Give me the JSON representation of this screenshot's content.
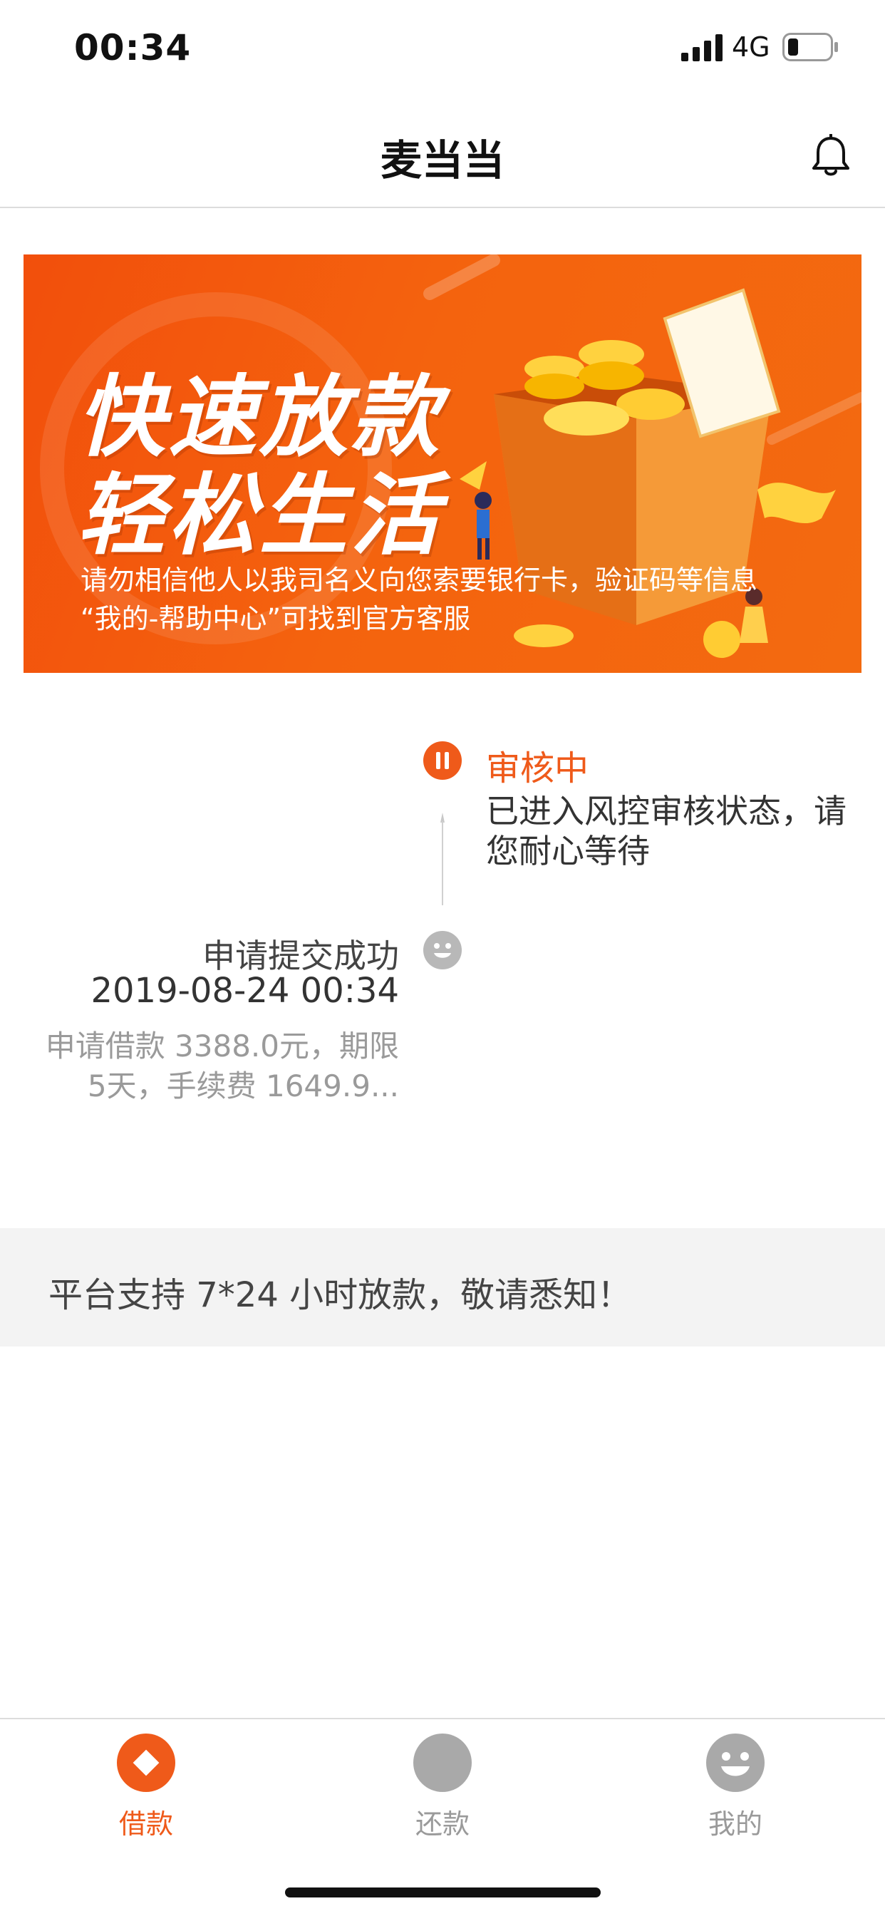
{
  "status_bar": {
    "time": "00:34",
    "network": "4G",
    "icons": [
      "signal-bars-icon",
      "battery-icon"
    ]
  },
  "nav": {
    "title": "麦当当",
    "right_icon": "bell-icon"
  },
  "banner": {
    "headline_line1": "快速放款",
    "headline_line2": "轻松生活",
    "warning_line1": "请勿相信他人以我司名义向您索要银行卡，验证码等信息",
    "warning_line2": "“我的-帮助中心”可找到官方客服"
  },
  "timeline": {
    "review": {
      "title": "审核中",
      "description": "已进入风控审核状态，请您耐心等待",
      "icon": "pause-icon"
    },
    "submitted": {
      "title": "申请提交成功",
      "time": "2019-08-24 00:34",
      "description": "申请借款 3388.0元，期限 5天，手续费 1649.9...",
      "icon": "smile-icon"
    }
  },
  "notice": {
    "text": "平台支持 7*24 小时放款，敬请悉知！"
  },
  "tabbar": {
    "tabs": [
      {
        "label": "借款",
        "icon": "diamond-icon",
        "active": true
      },
      {
        "label": "还款",
        "icon": "circle-icon",
        "active": false
      },
      {
        "label": "我的",
        "icon": "smile-face-icon",
        "active": false
      }
    ]
  },
  "colors": {
    "accent": "#ef5a1a",
    "banner": "#f4630e",
    "inactive": "#a9a9a9",
    "notice_bg": "#f3f3f3"
  }
}
